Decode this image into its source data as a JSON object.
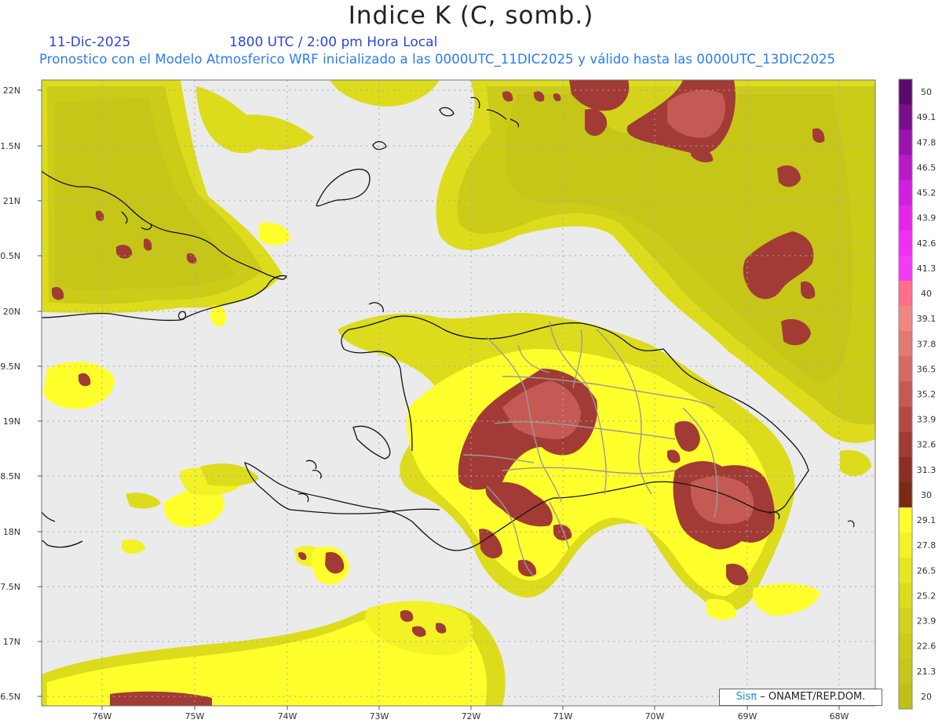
{
  "header": {
    "title": "Indice K (C, somb.)",
    "date": "11-Dic-2025",
    "time": "1800 UTC / 2:00 pm Hora Local",
    "description": "Pronostico con el Modelo Atmosferico WRF inicializado a las 0000UTC_11DIC2025 y válido hasta las  0000UTC_13DIC2025"
  },
  "axes": {
    "lat_labels": [
      "22N",
      "1.5N",
      "21N",
      "0.5N",
      "20N",
      "9.5N",
      "19N",
      "8.5N",
      "18N",
      "7.5N",
      "17N",
      "6.5N"
    ],
    "lon_labels": [
      "76W",
      "75W",
      "74W",
      "73W",
      "72W",
      "71W",
      "70W",
      "69W",
      "68W"
    ]
  },
  "colorbar": {
    "labels": [
      "50",
      "49.1",
      "47.8",
      "46.5",
      "45.2",
      "43.9",
      "42.6",
      "41.3",
      "40",
      "39.1",
      "37.8",
      "36.5",
      "35.2",
      "33.9",
      "32.6",
      "31.3",
      "30",
      "29.1",
      "27.8",
      "26.5",
      "25.2",
      "23.9",
      "22.6",
      "21.3",
      "20"
    ],
    "colors": [
      "#5a0a6a",
      "#7a0f8c",
      "#9a14ac",
      "#b81ac8",
      "#d21fe0",
      "#e624ee",
      "#f02ef5",
      "#f739f9",
      "#ff6e8a",
      "#f0877f",
      "#e07a72",
      "#d36a63",
      "#c55a54",
      "#b34b44",
      "#a23b35",
      "#8c2e25",
      "#7a2a12",
      "#ffff2c",
      "#f3f225",
      "#e6e620",
      "#dbdc1c",
      "#d2d31a",
      "#cbcc18",
      "#c5c618",
      "#bfbf17"
    ]
  },
  "credit": {
    "brand": "Sisπ",
    "text": "– ONAMET/REP.DOM."
  }
}
